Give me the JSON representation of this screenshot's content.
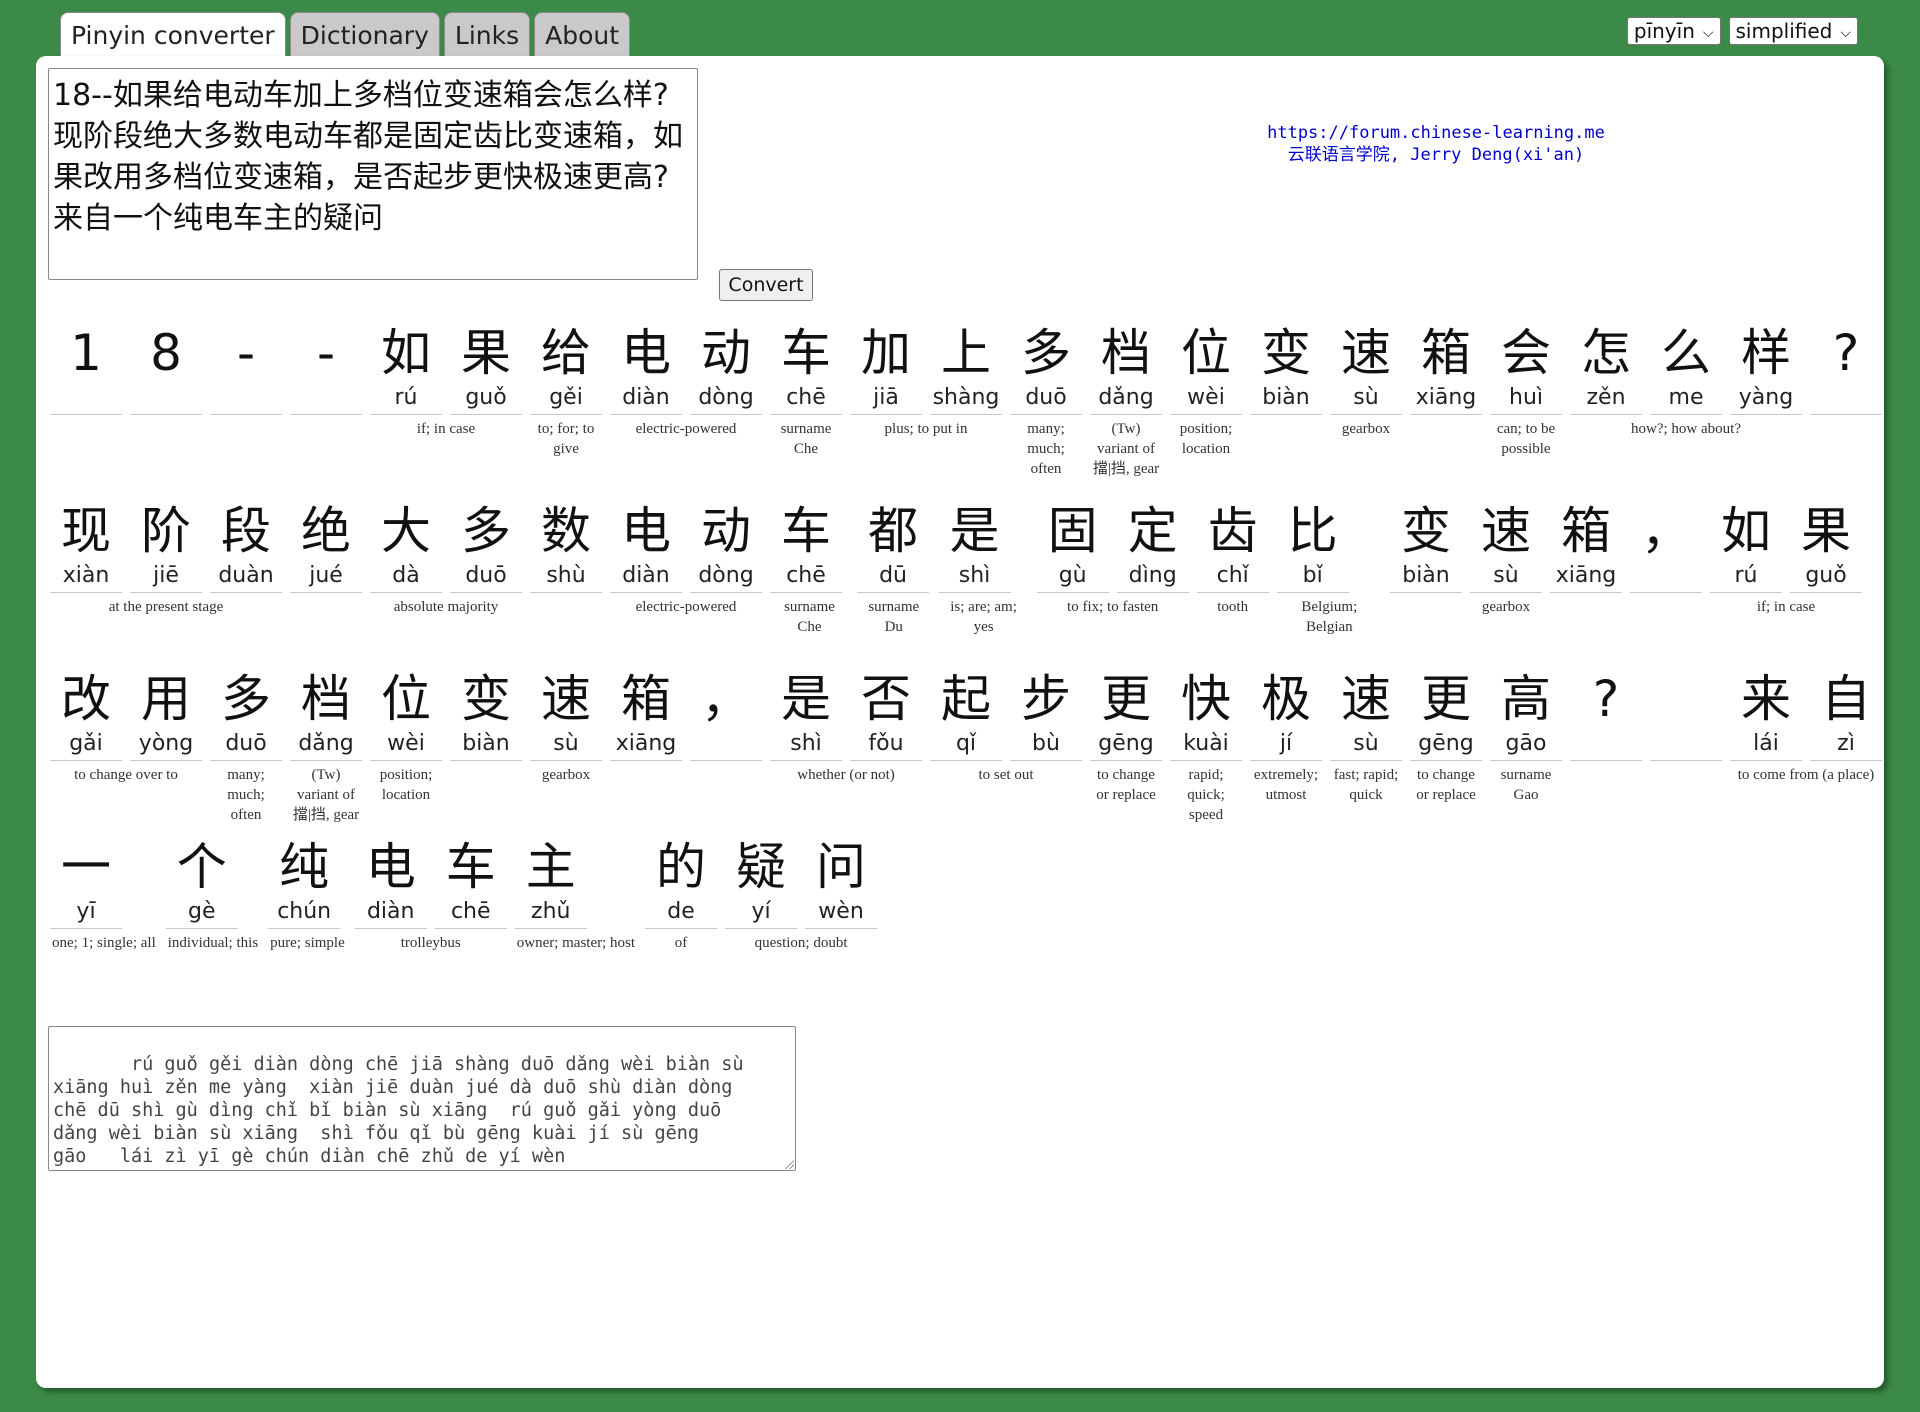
{
  "tabs": [
    {
      "label": "Pinyin converter",
      "active": true
    },
    {
      "label": "Dictionary",
      "active": false
    },
    {
      "label": "Links",
      "active": false
    },
    {
      "label": "About",
      "active": false
    }
  ],
  "selects": {
    "tone_style": "pīnyīn",
    "script": "simplified"
  },
  "input_text": "18--如果给电动车加上多档位变速箱会怎么样?\n现阶段绝大多数电动车都是固定齿比变速箱，如果改用多档位变速箱，是否起步更快极速更高?\n来自一个纯电车主的疑问",
  "convert_label": "Convert",
  "credit": {
    "url": "https://forum.chinese-learning.me",
    "line2": "云联语言学院, Jerry Deng(xi'an)"
  },
  "rows": [
    [
      {
        "chars": [
          {
            "c": "1",
            "p": ""
          }
        ],
        "gloss": ""
      },
      {
        "chars": [
          {
            "c": "8",
            "p": ""
          }
        ],
        "gloss": ""
      },
      {
        "chars": [
          {
            "c": "-",
            "p": ""
          }
        ],
        "gloss": ""
      },
      {
        "chars": [
          {
            "c": "-",
            "p": ""
          }
        ],
        "gloss": ""
      },
      {
        "chars": [
          {
            "c": "如",
            "p": "rú"
          },
          {
            "c": "果",
            "p": "guǒ"
          }
        ],
        "gloss": "if; in case"
      },
      {
        "chars": [
          {
            "c": "给",
            "p": "gěi"
          }
        ],
        "gloss": "to; for; to give"
      },
      {
        "chars": [
          {
            "c": "电",
            "p": "diàn"
          },
          {
            "c": "动",
            "p": "dòng"
          }
        ],
        "gloss": "electric-powered"
      },
      {
        "chars": [
          {
            "c": "车",
            "p": "chē"
          }
        ],
        "gloss": "surname Che"
      },
      {
        "chars": [
          {
            "c": "加",
            "p": "jiā"
          },
          {
            "c": "上",
            "p": "shàng"
          }
        ],
        "gloss": "plus; to put in"
      },
      {
        "chars": [
          {
            "c": "多",
            "p": "duō"
          }
        ],
        "gloss": "many; much; often"
      },
      {
        "chars": [
          {
            "c": "档",
            "p": "dǎng"
          }
        ],
        "gloss": "(Tw) variant of 擋|挡, gear"
      },
      {
        "chars": [
          {
            "c": "位",
            "p": "wèi"
          }
        ],
        "gloss": "position; location"
      },
      {
        "chars": [
          {
            "c": "变",
            "p": "biàn"
          },
          {
            "c": "速",
            "p": "sù"
          },
          {
            "c": "箱",
            "p": "xiāng"
          }
        ],
        "gloss": "gearbox"
      },
      {
        "chars": [
          {
            "c": "会",
            "p": "huì"
          }
        ],
        "gloss": "can; to be possible"
      },
      {
        "chars": [
          {
            "c": "怎",
            "p": "zěn"
          },
          {
            "c": "么",
            "p": "me"
          },
          {
            "c": "样",
            "p": "yàng"
          }
        ],
        "gloss": "how?; how about?"
      },
      {
        "chars": [
          {
            "c": "?",
            "p": ""
          }
        ],
        "gloss": ""
      }
    ],
    [
      {
        "chars": [
          {
            "c": "现",
            "p": "xiàn"
          },
          {
            "c": "阶",
            "p": "jiē"
          },
          {
            "c": "段",
            "p": "duàn"
          }
        ],
        "gloss": "at the present stage"
      },
      {
        "chars": [
          {
            "c": "绝",
            "p": "jué"
          },
          {
            "c": "大",
            "p": "dà"
          },
          {
            "c": "多",
            "p": "duō"
          },
          {
            "c": "数",
            "p": "shù"
          }
        ],
        "gloss": "absolute majority"
      },
      {
        "chars": [
          {
            "c": "电",
            "p": "diàn"
          },
          {
            "c": "动",
            "p": "dòng"
          }
        ],
        "gloss": "electric-powered"
      },
      {
        "chars": [
          {
            "c": "车",
            "p": "chē"
          }
        ],
        "gloss": "surname Che"
      },
      {
        "chars": [
          {
            "c": "都",
            "p": "dū"
          }
        ],
        "gloss": "surname Du"
      },
      {
        "chars": [
          {
            "c": "是",
            "p": "shì"
          }
        ],
        "gloss": "is; are; am; yes"
      },
      {
        "chars": [
          {
            "c": "固",
            "p": "gù"
          },
          {
            "c": "定",
            "p": "dìng"
          }
        ],
        "gloss": "to fix; to fasten"
      },
      {
        "chars": [
          {
            "c": "齿",
            "p": "chǐ"
          }
        ],
        "gloss": "tooth"
      },
      {
        "chars": [
          {
            "c": "比",
            "p": "bǐ"
          }
        ],
        "gloss": "Belgium; Belgian"
      },
      {
        "chars": [
          {
            "c": "变",
            "p": "biàn"
          },
          {
            "c": "速",
            "p": "sù"
          },
          {
            "c": "箱",
            "p": "xiāng"
          }
        ],
        "gloss": "gearbox"
      },
      {
        "chars": [
          {
            "c": "，",
            "p": ""
          }
        ],
        "gloss": ""
      },
      {
        "chars": [
          {
            "c": "如",
            "p": "rú"
          },
          {
            "c": "果",
            "p": "guǒ"
          }
        ],
        "gloss": "if; in case"
      }
    ],
    [
      {
        "chars": [
          {
            "c": "改",
            "p": "gǎi"
          },
          {
            "c": "用",
            "p": "yòng"
          }
        ],
        "gloss": "to change over to"
      },
      {
        "chars": [
          {
            "c": "多",
            "p": "duō"
          }
        ],
        "gloss": "many; much; often"
      },
      {
        "chars": [
          {
            "c": "档",
            "p": "dǎng"
          }
        ],
        "gloss": "(Tw) variant of 擋|挡, gear"
      },
      {
        "chars": [
          {
            "c": "位",
            "p": "wèi"
          }
        ],
        "gloss": "position; location"
      },
      {
        "chars": [
          {
            "c": "变",
            "p": "biàn"
          },
          {
            "c": "速",
            "p": "sù"
          },
          {
            "c": "箱",
            "p": "xiāng"
          }
        ],
        "gloss": "gearbox"
      },
      {
        "chars": [
          {
            "c": "，",
            "p": ""
          }
        ],
        "gloss": ""
      },
      {
        "chars": [
          {
            "c": "是",
            "p": "shì"
          },
          {
            "c": "否",
            "p": "fǒu"
          }
        ],
        "gloss": "whether (or not)"
      },
      {
        "chars": [
          {
            "c": "起",
            "p": "qǐ"
          },
          {
            "c": "步",
            "p": "bù"
          }
        ],
        "gloss": "to set out"
      },
      {
        "chars": [
          {
            "c": "更",
            "p": "gēng"
          }
        ],
        "gloss": "to change or replace"
      },
      {
        "chars": [
          {
            "c": "快",
            "p": "kuài"
          }
        ],
        "gloss": "rapid; quick; speed"
      },
      {
        "chars": [
          {
            "c": "极",
            "p": "jí"
          }
        ],
        "gloss": "extremely; utmost"
      },
      {
        "chars": [
          {
            "c": "速",
            "p": "sù"
          }
        ],
        "gloss": "fast; rapid; quick"
      },
      {
        "chars": [
          {
            "c": "更",
            "p": "gēng"
          }
        ],
        "gloss": "to change or replace"
      },
      {
        "chars": [
          {
            "c": "高",
            "p": "gāo"
          }
        ],
        "gloss": "surname Gao"
      },
      {
        "chars": [
          {
            "c": "?",
            "p": ""
          }
        ],
        "gloss": ""
      },
      {
        "chars": [
          {
            "c": "",
            "p": ""
          }
        ],
        "gloss": ""
      },
      {
        "chars": [
          {
            "c": "来",
            "p": "lái"
          },
          {
            "c": "自",
            "p": "zì"
          }
        ],
        "gloss": "to come from (a place)"
      }
    ],
    [
      {
        "chars": [
          {
            "c": "一",
            "p": "yī"
          }
        ],
        "gloss": "one; 1; single; all"
      },
      {
        "chars": [
          {
            "c": "个",
            "p": "gè"
          }
        ],
        "gloss": "individual; this"
      },
      {
        "chars": [
          {
            "c": "纯",
            "p": "chún"
          }
        ],
        "gloss": "pure; simple"
      },
      {
        "chars": [
          {
            "c": "电",
            "p": "diàn"
          },
          {
            "c": "车",
            "p": "chē"
          }
        ],
        "gloss": "trolleybus"
      },
      {
        "chars": [
          {
            "c": "主",
            "p": "zhǔ"
          }
        ],
        "gloss": "owner; master; host"
      },
      {
        "chars": [
          {
            "c": "的",
            "p": "de"
          }
        ],
        "gloss": "of"
      },
      {
        "chars": [
          {
            "c": "疑",
            "p": "yí"
          },
          {
            "c": "问",
            "p": "wèn"
          }
        ],
        "gloss": "question; doubt"
      }
    ]
  ],
  "output_text": "   rú guǒ gěi diàn dòng chē jiā shàng duō dǎng wèi biàn sù\nxiāng huì zěn me yàng  xiàn jiē duàn jué dà duō shù diàn dòng\nchē dū shì gù dìng chǐ bǐ biàn sù xiāng  rú guǒ gǎi yòng duō\ndǎng wèi biàn sù xiāng  shì fǒu qǐ bù gēng kuài jí sù gēng\ngāo   lái zì yī gè chún diàn chē zhǔ de yí wèn"
}
